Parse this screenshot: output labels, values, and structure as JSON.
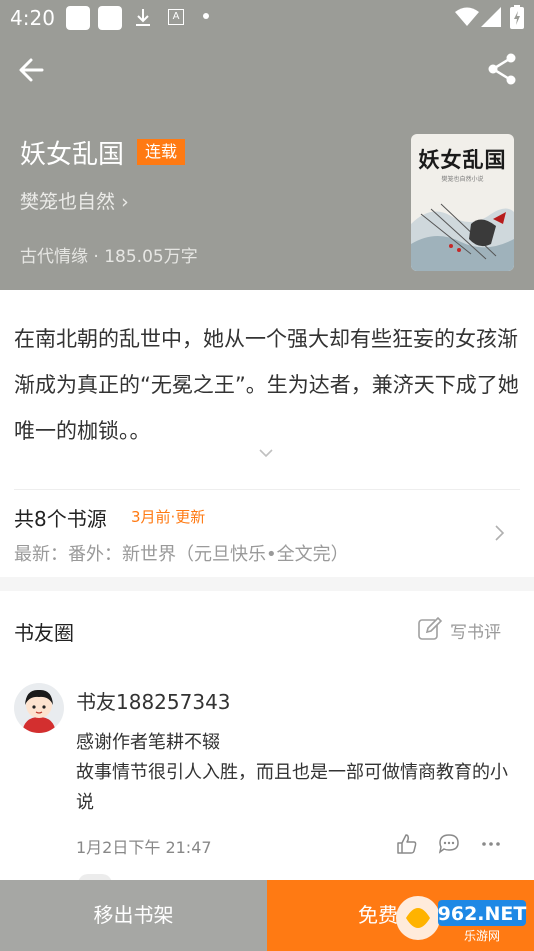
{
  "status_bar": {
    "time": "4:20",
    "a_icon_letter": "A"
  },
  "book": {
    "title": "妖女乱国",
    "status_badge": "连载",
    "author": "樊笼也自然",
    "author_arrow": "›",
    "meta": "古代情缘 · 185.05万字",
    "cover_title": "妖女乱国",
    "cover_subtitle": "樊笼也自然小说"
  },
  "description": "在南北朝的乱世中，她从一个强大却有些狂妄的女孩渐渐成为真正的“无冕之王”。生为达者，兼济天下成了她唯一的枷锁。。",
  "sources": {
    "count_label": "共8个书源",
    "updated": "3月前·更新",
    "latest": "最新：番外：新世界（元旦快乐•全文完）"
  },
  "circle": {
    "title": "书友圈",
    "write_review": "写书评",
    "comment": {
      "user": "书友188257343",
      "text_line1": "感谢作者笔耕不辍",
      "text_line2": "故事情节很引人入胜，而且也是一部可做情商教育的小说",
      "time": "1月2日下午 21:47"
    }
  },
  "bottom_bar": {
    "remove_label": "移出书架",
    "read_label": "免费"
  },
  "watermark": {
    "text": "962.NET",
    "subtext": "乐游网"
  },
  "colors": {
    "accent": "#ff7a13",
    "header_bg": "#9b9c97",
    "remove_bg": "#a6a7a4"
  },
  "icons": [
    "back-icon",
    "share-icon",
    "chevron-down-icon",
    "chevron-right-icon",
    "edit-icon",
    "thumbs-up-icon",
    "comment-icon",
    "more-icon",
    "download-icon",
    "wifi-icon",
    "signal-icon",
    "battery-icon"
  ]
}
